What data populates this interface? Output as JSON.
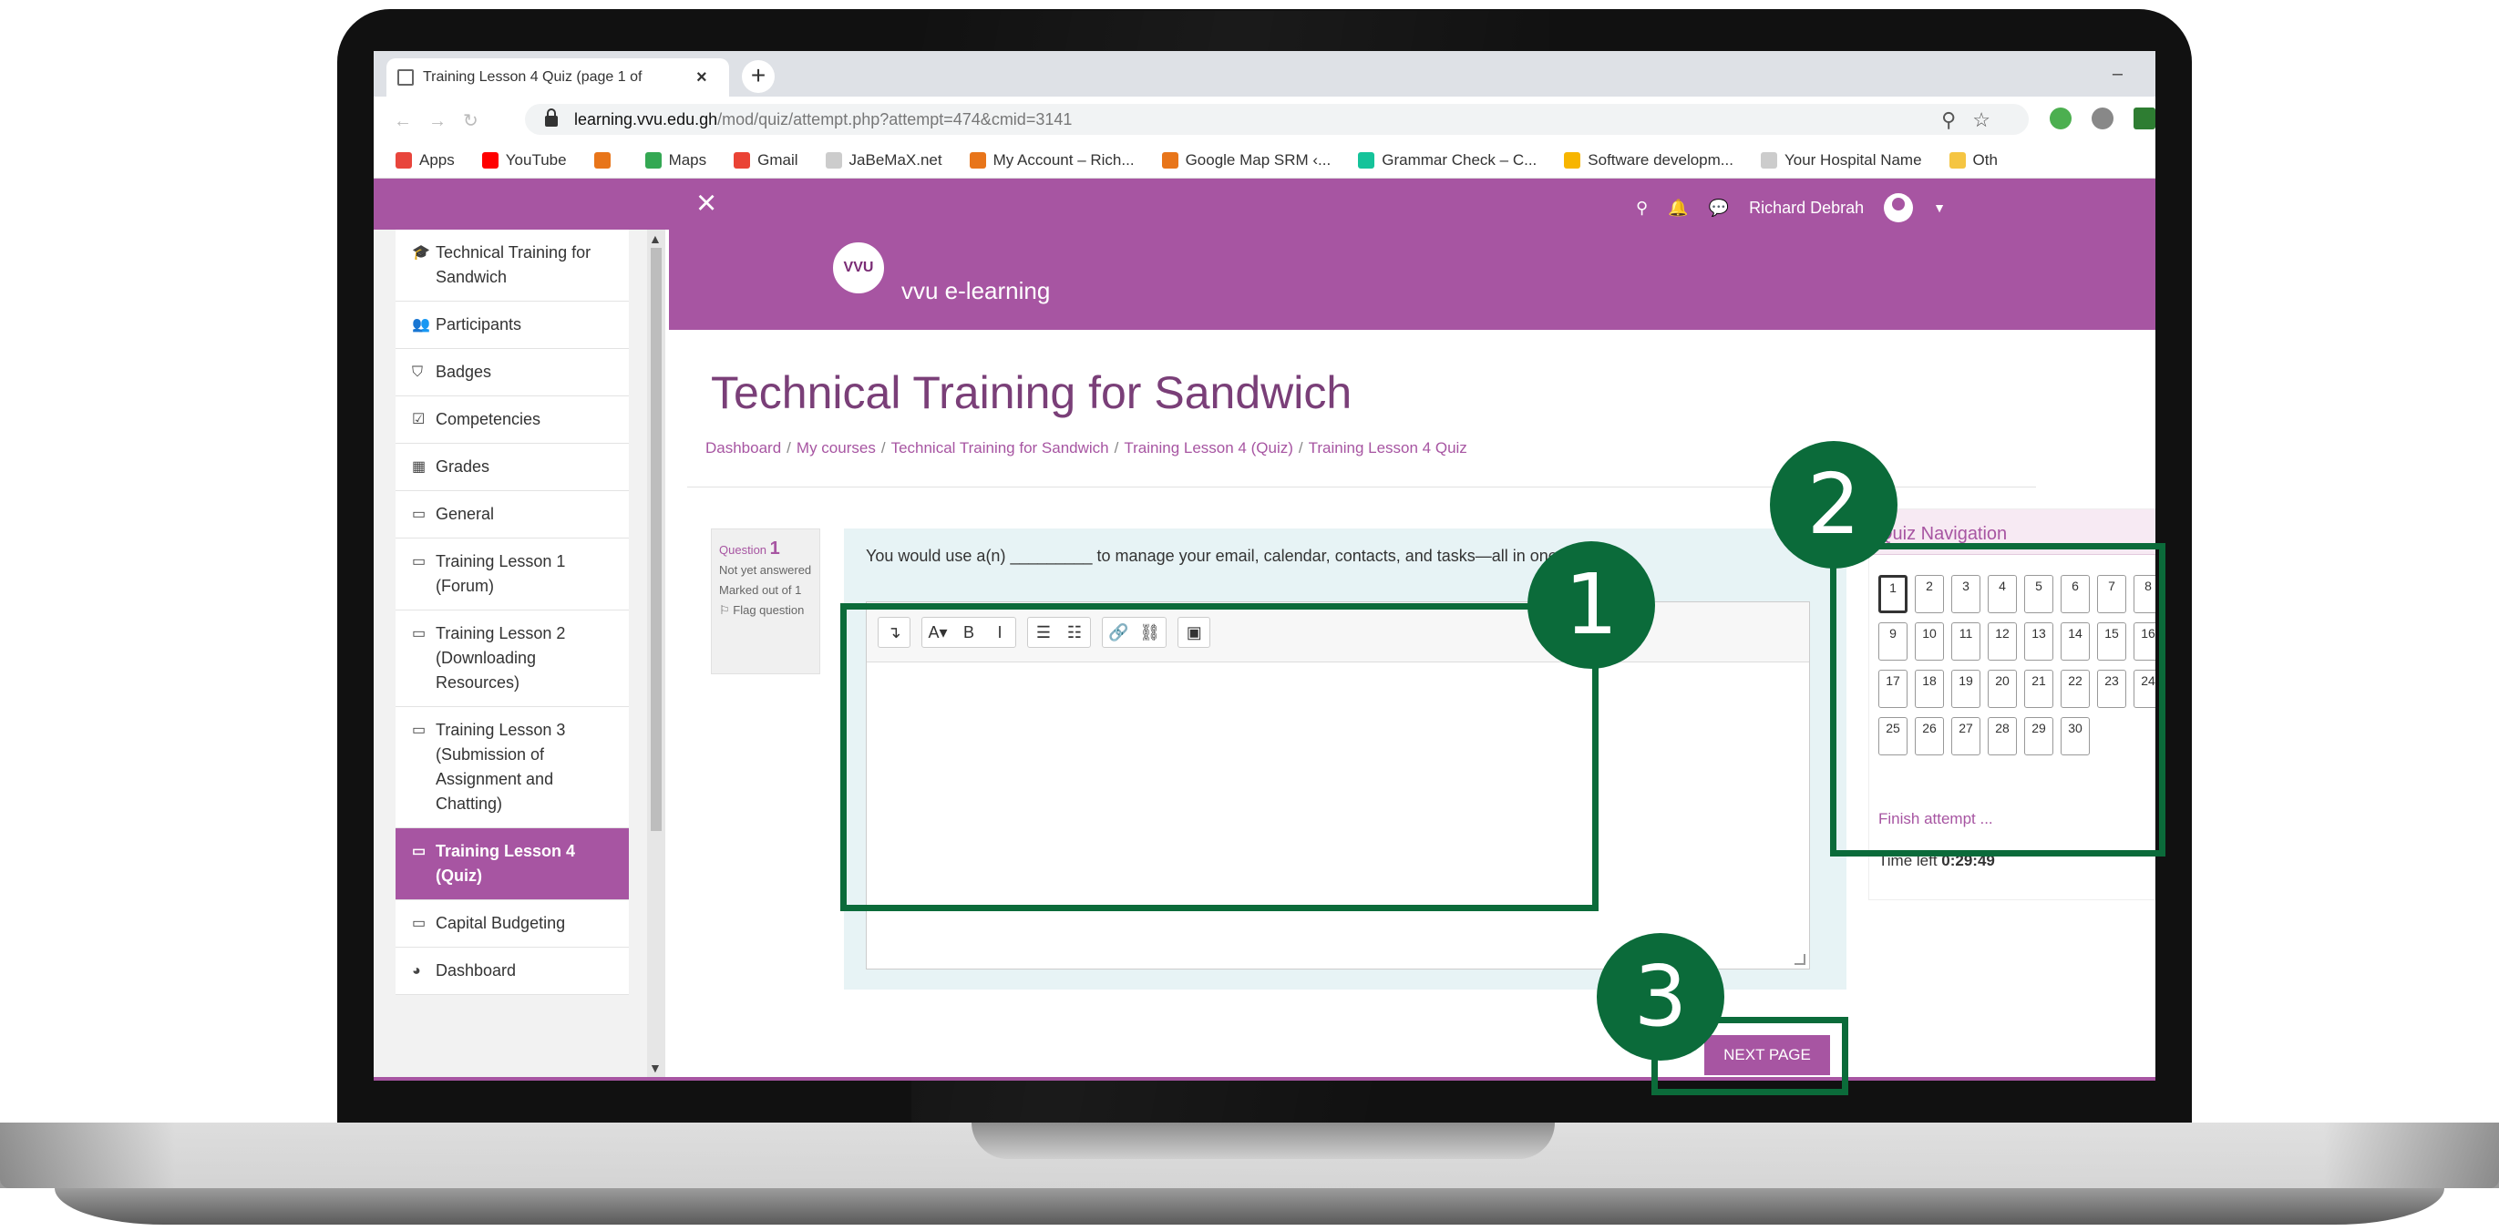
{
  "browser": {
    "tab_title": "Training Lesson 4 Quiz (page 1 of",
    "tab_close": "×",
    "new_tab": "+",
    "minimize": "–",
    "url_host": "learning.vvu.edu.gh",
    "url_path": "/mod/quiz/attempt.php?attempt=474&cmid=3141",
    "bookmarks": [
      {
        "label": "Apps",
        "color": "#e8453c"
      },
      {
        "label": "YouTube",
        "color": "#ff0000"
      },
      {
        "label": "",
        "color": "#e8751a"
      },
      {
        "label": "Maps",
        "color": "#34a853"
      },
      {
        "label": "Gmail",
        "color": "#ea4335"
      },
      {
        "label": "JaBeMaX.net",
        "color": "#cccccc"
      },
      {
        "label": "My Account – Rich...",
        "color": "#e8751a"
      },
      {
        "label": "Google Map SRM ‹...",
        "color": "#e8751a"
      },
      {
        "label": "Grammar Check – C...",
        "color": "#15c39a"
      },
      {
        "label": "Software developm...",
        "color": "#f7b500"
      },
      {
        "label": "Your Hospital Name",
        "color": "#cccccc"
      },
      {
        "label": "Oth",
        "color": "#f5c542"
      }
    ]
  },
  "topnav": {
    "close": "×",
    "user_name": "Richard Debrah"
  },
  "sidebar": {
    "items": [
      {
        "icon": "graduation-cap-icon",
        "glyph": "🎓",
        "label": "Technical Training for Sandwich",
        "active": false
      },
      {
        "icon": "users-icon",
        "glyph": "👥",
        "label": "Participants",
        "active": false
      },
      {
        "icon": "shield-icon",
        "glyph": "⛉",
        "label": "Badges",
        "active": false
      },
      {
        "icon": "check-square-icon",
        "glyph": "☑",
        "label": "Competencies",
        "active": false
      },
      {
        "icon": "table-icon",
        "glyph": "▦",
        "label": "Grades",
        "active": false
      },
      {
        "icon": "folder-icon",
        "glyph": "▭",
        "label": "General",
        "active": false
      },
      {
        "icon": "folder-icon",
        "glyph": "▭",
        "label": "Training Lesson 1 (Forum)",
        "active": false
      },
      {
        "icon": "folder-icon",
        "glyph": "▭",
        "label": "Training Lesson 2 (Downloading Resources)",
        "active": false
      },
      {
        "icon": "folder-icon",
        "glyph": "▭",
        "label": "Training Lesson 3 (Submission of Assignment and Chatting)",
        "active": false
      },
      {
        "icon": "folder-icon",
        "glyph": "▭",
        "label": "Training Lesson 4 (Quiz)",
        "active": true
      },
      {
        "icon": "folder-icon",
        "glyph": "▭",
        "label": "Capital Budgeting",
        "active": false
      },
      {
        "icon": "dashboard-icon",
        "glyph": "◕",
        "label": "Dashboard",
        "active": false
      }
    ]
  },
  "banner": {
    "logo_mark": "VVU",
    "logo_text": "vvu e-learning"
  },
  "page": {
    "title": "Technical Training for Sandwich",
    "breadcrumb": [
      "Dashboard",
      "My courses",
      "Technical Training for Sandwich",
      "Training Lesson 4 (Quiz)",
      "Training Lesson 4 Quiz"
    ]
  },
  "question": {
    "label": "Question",
    "number": "1",
    "state": "Not yet answered",
    "marks": "Marked out of 1",
    "flag": "Flag question",
    "text": "You would use a(n) _________ to manage your email, calendar, contacts, and tasks—all in one pl"
  },
  "editor": {
    "toolbar": [
      "↴",
      "A▾",
      "B",
      "I",
      "☰",
      "☷",
      "🔗",
      "⛓",
      "▣"
    ]
  },
  "quiz_nav": {
    "title": "Quiz Navigation",
    "questions": [
      "1",
      "2",
      "3",
      "4",
      "5",
      "6",
      "7",
      "8",
      "9",
      "10",
      "11",
      "12",
      "13",
      "14",
      "15",
      "16",
      "17",
      "18",
      "19",
      "20",
      "21",
      "22",
      "23",
      "24",
      "25",
      "26",
      "27",
      "28",
      "29",
      "30"
    ],
    "current": "1",
    "finish": "Finish attempt ...",
    "time_label": "Time left",
    "time_value": "0:29:49"
  },
  "next_button": "NEXT PAGE",
  "annotations": [
    {
      "number": "1",
      "color": "#0b6b3a"
    },
    {
      "number": "2",
      "color": "#0b6b3a"
    },
    {
      "number": "3",
      "color": "#0b6b3a"
    }
  ]
}
